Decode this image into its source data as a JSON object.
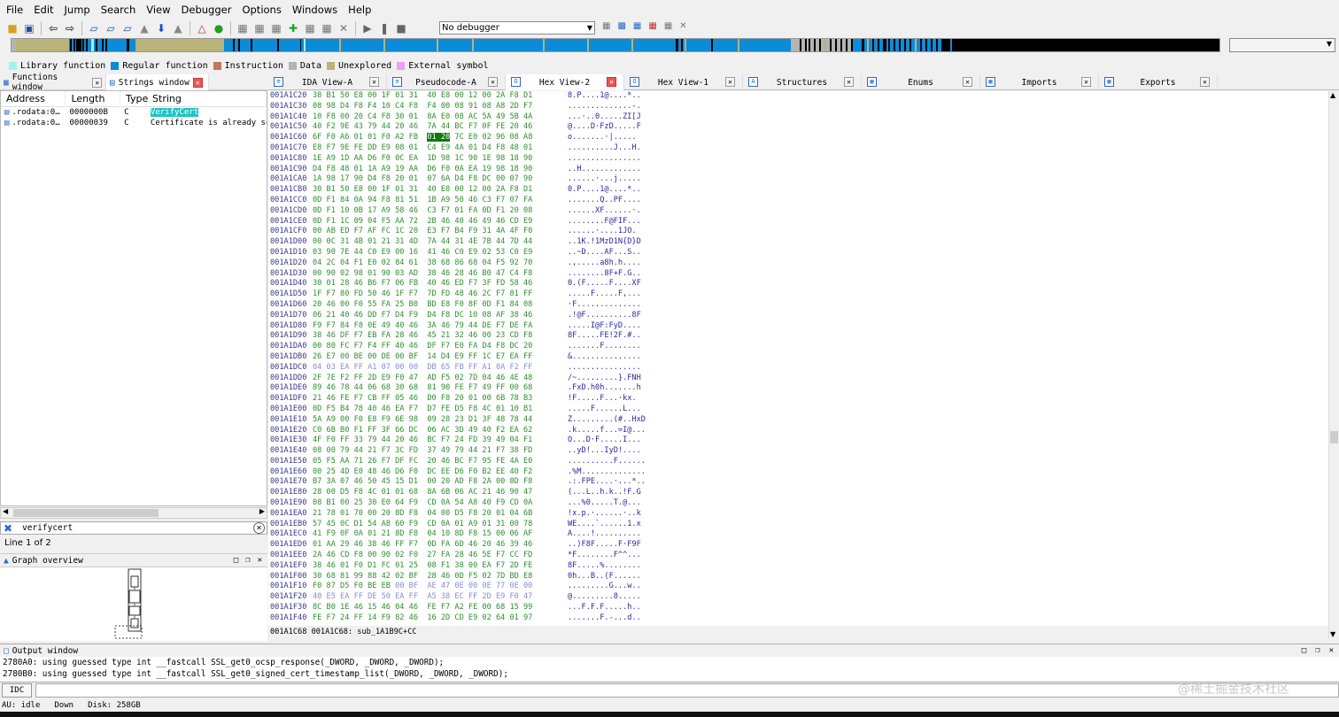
{
  "menu": [
    "File",
    "Edit",
    "Jump",
    "Search",
    "View",
    "Debugger",
    "Options",
    "Windows",
    "Help"
  ],
  "toolbar": {
    "debugger_select": "No debugger"
  },
  "legend": [
    {
      "label": "Library function",
      "color": "#a6f0f0"
    },
    {
      "label": "Regular function",
      "color": "#0b8bd8"
    },
    {
      "label": "Instruction",
      "color": "#c07858"
    },
    {
      "label": "Data",
      "color": "#b4b4b4"
    },
    {
      "label": "Unexplored",
      "color": "#b8b47a"
    },
    {
      "label": "External symbol",
      "color": "#f0a0f0"
    }
  ],
  "left_tabs": [
    {
      "label": "Functions window"
    },
    {
      "label": "Strings window"
    }
  ],
  "strings": {
    "headers": [
      "Address",
      "Length",
      "Type",
      "String"
    ],
    "rows": [
      {
        "address": ".rodata:0…",
        "length": "0000000B",
        "type": "C",
        "string": "VerifyCert"
      },
      {
        "address": ".rodata:0…",
        "length": "00000039",
        "type": "C",
        "string": "Certificate is already set"
      }
    ],
    "filter": "verifycert",
    "line_count": "Line 1 of 2"
  },
  "graph_overview": {
    "title": "Graph overview"
  },
  "right_tabs": [
    {
      "label": "IDA View-A",
      "icon": "≡"
    },
    {
      "label": "Pseudocode-A",
      "icon": "≡"
    },
    {
      "label": "Hex View-2",
      "icon": "O"
    },
    {
      "label": "Hex View-1",
      "icon": "O"
    },
    {
      "label": "Structures",
      "icon": "A"
    },
    {
      "label": "Enums",
      "icon": "▦"
    },
    {
      "label": "Imports",
      "icon": "▦"
    },
    {
      "label": "Exports",
      "icon": "▦"
    }
  ],
  "hex_rows": [
    {
      "addr": "001A1C20",
      "bytes": "38 B1 50 E8 00 1F 01 31  40 E8 00 12 00 2A F8 D1",
      "ascii": "8.P....1@....*.."
    },
    {
      "addr": "001A1C30",
      "bytes": "08 98 D4 F8 F4 10 C4 F8  F4 00 08 91 08 A8 2D F7",
      "ascii": "..............-."
    },
    {
      "addr": "001A1C40",
      "bytes": "10 F8 00 20 C4 F8 30 01  8A E0 08 AC 5A 49 5B 4A",
      "ascii": "...·..0.....ZI[J"
    },
    {
      "addr": "001A1C50",
      "bytes": "40 F2 9E 43 79 44 20 46  7A 44 BC F7 0F FE 20 46",
      "ascii": "@....D·FzD.....F"
    },
    {
      "addr": "001A1C60",
      "bytes": "6F F0 A6 01 01 F0 A2 FB  01 20 7C E0 02 96 08 A8",
      "ascii": "o.......·|....."
    },
    {
      "addr": "001A1C70",
      "bytes": "E8 F7 9E FE DD E9 08 01  C4 E9 4A 01 D4 F8 48 01",
      "ascii": "..........J...H."
    },
    {
      "addr": "001A1C80",
      "bytes": "1E A9 1D AA D6 F0 0C EA  1D 98 1C 90 1E 98 18 90",
      "ascii": "................"
    },
    {
      "addr": "001A1C90",
      "bytes": "D4 F8 48 01 1A A9 19 AA  D6 F0 0A EA 19 98 18 90",
      "ascii": "..H............."
    },
    {
      "addr": "001A1CA0",
      "bytes": "1A 98 17 90 D4 F8 20 01  07 6A D4 F8 DC 00 07 90",
      "ascii": "......·...j....."
    },
    {
      "addr": "001A1CB0",
      "bytes": "30 B1 50 E8 00 1F 01 31  40 E8 00 12 00 2A F8 D1",
      "ascii": "0.P....1@....*.."
    },
    {
      "addr": "001A1CC0",
      "bytes": "0D F1 84 0A 94 F8 81 51  1B A9 50 46 C3 F7 07 FA",
      "ascii": ".......Q..PF...."
    },
    {
      "addr": "001A1CD0",
      "bytes": "0D F1 10 0B 17 A9 58 46  C3 F7 01 FA 0D F1 20 08",
      "ascii": "......XF......·."
    },
    {
      "addr": "001A1CE0",
      "bytes": "0D F1 1C 09 04 F5 AA 72  2B 46 40 46 49 46 CD E9",
      "ascii": "........F@FIF..."
    },
    {
      "addr": "001A1CF0",
      "bytes": "00 AB ED F7 AF FC 1C 20  E3 F7 B4 F9 31 4A 4F F0",
      "ascii": "......·....1JO."
    },
    {
      "addr": "001A1D00",
      "bytes": "00 0C 31 4B 01 21 31 4D  7A 44 31 4E 7B 44 7D 44",
      "ascii": "..1K.!1MzD1N{D}D"
    },
    {
      "addr": "001A1D10",
      "bytes": "03 90 7E 44 C0 E9 00 16  41 46 C0 E9 02 53 C0 E9",
      "ascii": "..~D....AF...S.."
    },
    {
      "addr": "001A1D20",
      "bytes": "04 2C 04 F1 E0 02 84 61  38 68 86 68 04 F5 92 70",
      "ascii": ".,.....a8h.h...."
    },
    {
      "addr": "001A1D30",
      "bytes": "00 90 02 98 01 90 03 AD  38 46 28 46 B0 47 C4 F8",
      "ascii": "........8F+F.G.."
    },
    {
      "addr": "001A1D40",
      "bytes": "30 01 28 46 B6 F7 06 FB  40 46 ED F7 3F FD 58 46",
      "ascii": "0.(F.....F....XF"
    },
    {
      "addr": "001A1D50",
      "bytes": "1F F7 80 FD 50 46 1F F7  7D FD 48 46 2C F7 81 FF",
      "ascii": ".....F.....F,..."
    },
    {
      "addr": "001A1D60",
      "bytes": "20 46 00 F0 55 FA 25 B0  BD E8 F0 8F 0D F1 84 08",
      "ascii": "·F.............."
    },
    {
      "addr": "001A1D70",
      "bytes": "06 21 40 46 DD F7 D4 F9  D4 F8 DC 10 08 AF 38 46",
      "ascii": ".!@F..........8F"
    },
    {
      "addr": "001A1D80",
      "bytes": "F9 F7 84 F8 0E 49 40 46  3A 46 79 44 DE F7 DE FA",
      "ascii": ".....I@F:FyD...."
    },
    {
      "addr": "001A1D90",
      "bytes": "38 46 DF F7 EB FA 28 46  45 21 32 46 00 23 CD F8",
      "ascii": "8F.....FE!2F.#.."
    },
    {
      "addr": "001A1DA0",
      "bytes": "00 80 FC F7 F4 FF 40 46  DF F7 E0 FA D4 F8 DC 20",
      "ascii": ".......F........"
    },
    {
      "addr": "001A1DB0",
      "bytes": "26 E7 00 BE 00 DE 00 BF  14 D4 E9 FF 1C E7 EA FF",
      "ascii": "&..............."
    },
    {
      "addr": "001A1DC0",
      "bytes": "04 03 EA FF A1 07 00 00  DB 65 FB FF A1 0A F2 FF",
      "ascii": "................",
      "dim": true
    },
    {
      "addr": "001A1DD0",
      "bytes": "2F 7E F2 FF 2D E9 F0 47  AD F5 02 7D 04 46 4E 48",
      "ascii": "/~.........}.FNH"
    },
    {
      "addr": "001A1DE0",
      "bytes": "89 46 78 44 06 68 30 68  81 90 FE F7 49 FF 00 68",
      "ascii": ".FxD.h0h.......h"
    },
    {
      "addr": "001A1DF0",
      "bytes": "21 46 FE F7 CB FF 05 46  D0 F8 20 01 00 6B 78 B3",
      "ascii": "!F.....F...·kx."
    },
    {
      "addr": "001A1E00",
      "bytes": "0D F5 B4 78 40 46 EA F7  D7 FE D5 F8 4C 01 10 B1",
      "ascii": ".....F......L..."
    },
    {
      "addr": "001A1E10",
      "bytes": "5A A9 00 F0 E8 F9 6E 98  09 28 23 D1 3F 48 78 44",
      "ascii": "Z.........(#..HxD"
    },
    {
      "addr": "001A1E20",
      "bytes": "C0 6B B0 F1 FF 3F 66 DC  06 AC 3D 49 40 F2 EA 62",
      "ascii": ".k.....f...=I@..."
    },
    {
      "addr": "001A1E30",
      "bytes": "4F F0 FF 33 79 44 20 46  BC F7 24 FD 39 49 04 F1",
      "ascii": "O...D·F.....I..."
    },
    {
      "addr": "001A1E40",
      "bytes": "08 00 79 44 21 F7 3C FD  37 49 79 44 21 F7 38 FD",
      "ascii": "..yD!...IyD!...."
    },
    {
      "addr": "001A1E50",
      "bytes": "05 F5 AA 71 26 F7 DF FC  20 46 BC F7 95 FE 4A E0",
      "ascii": "..........F......"
    },
    {
      "addr": "001A1E60",
      "bytes": "00 25 4D E0 48 46 D6 F0  DC EE D6 F0 B2 EE 40 F2",
      "ascii": ".%M.............."
    },
    {
      "addr": "001A1E70",
      "bytes": "B7 3A 07 46 50 45 15 D1  00 20 AD F8 2A 00 8D F8",
      "ascii": ".:.FPE....·...*.."
    },
    {
      "addr": "001A1E80",
      "bytes": "28 00 D5 F8 4C 01 01 68  8A 6B 06 AC 21 46 90 47",
      "ascii": "(...L..h.k..!F.G"
    },
    {
      "addr": "001A1E90",
      "bytes": "08 B1 00 25 30 E0 64 F9  CD 0A 54 A8 40 F9 CD 0A",
      "ascii": "...%0.....T.@..."
    },
    {
      "addr": "001A1EA0",
      "bytes": "21 78 01 70 00 20 8D F8  04 00 D5 F8 20 01 04 6B",
      "ascii": "!x.p.·......·..k"
    },
    {
      "addr": "001A1EB0",
      "bytes": "57 45 0C D1 54 A8 60 F9  CD 0A 01 A9 01 31 00 78",
      "ascii": "WE....`......1.x"
    },
    {
      "addr": "001A1EC0",
      "bytes": "41 F9 0F 0A 01 21 8D F8  04 10 8D F8 15 00 06 AF",
      "ascii": "A....!.........."
    },
    {
      "addr": "001A1ED0",
      "bytes": "01 AA 29 46 38 46 FF F7  0D FA 6D 46 20 46 39 46",
      "ascii": "..)F8F.....F·F9F"
    },
    {
      "addr": "001A1EE0",
      "bytes": "2A 46 CD F8 00 90 02 F0  27 FA 28 46 5E F7 CC FD",
      "ascii": "*F........F^^..."
    },
    {
      "addr": "001A1EF0",
      "bytes": "38 46 01 F0 D1 FC 01 25  08 F1 38 00 EA F7 2D FE",
      "ascii": "8F.....%........"
    },
    {
      "addr": "001A1F00",
      "bytes": "30 68 81 99 88 42 02 BF  28 46 0D F5 02 7D BD E8",
      "ascii": "0h...B..(F......"
    },
    {
      "addr": "001A1F10",
      "bytes": "F0 87 D5 F0 BE EB 00 BF  AE 47 0E 00 0E 77 0E 00",
      "ascii": ".........G...w..",
      "dimtail": true
    },
    {
      "addr": "001A1F20",
      "bytes": "40 E5 EA FF DE 50 EA FF  A5 38 EC FF 2D E9 F0 47",
      "ascii": "@.........8.....",
      "dim": true
    },
    {
      "addr": "001A1F30",
      "bytes": "8C B0 1E 46 15 46 04 46  FE F7 A2 FE 00 68 15 99",
      "ascii": "...F.F.F.....h.."
    },
    {
      "addr": "001A1F40",
      "bytes": "FE F7 24 FF 14 F9 82 46  16 2D CD E9 02 64 01 97",
      "ascii": ".......F.-...d.."
    }
  ],
  "hex_status": "001A1C68 001A1C68: sub_1A1B9C+CC",
  "output": {
    "title": "Output window",
    "lines": [
      "2780A0: using guessed type int __fastcall SSL_get0_ocsp_response(_DWORD, _DWORD, _DWORD);",
      "2780B0: using guessed type int __fastcall SSL_get0_signed_cert_timestamp_list(_DWORD, _DWORD, _DWORD);"
    ]
  },
  "idc_label": "IDC",
  "status": {
    "au": "AU:",
    "state": "idle",
    "direction": "Down",
    "disk": "Disk: 258GB"
  },
  "watermark": "@稀土掘金技术社区"
}
